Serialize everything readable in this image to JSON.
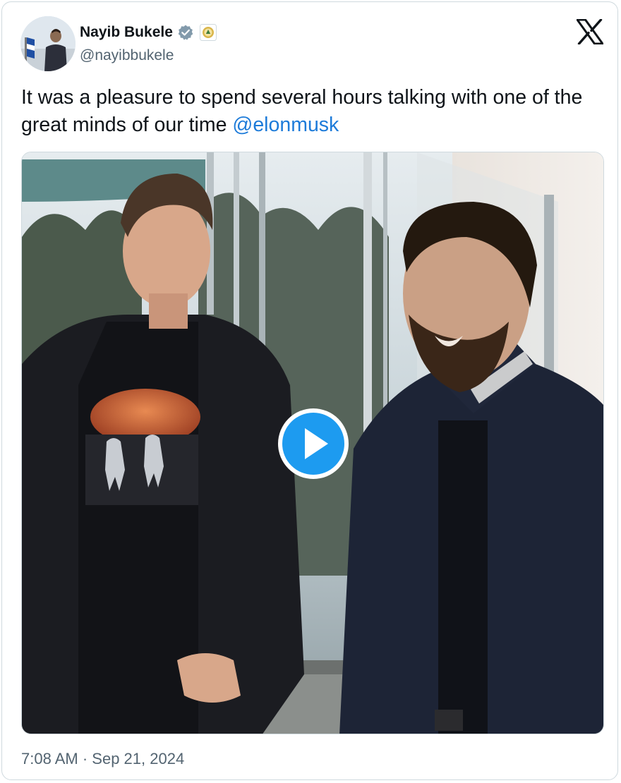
{
  "author": {
    "display_name": "Nayib Bukele",
    "handle": "@nayibbukele",
    "verified": true,
    "verified_icon": "verified-badge-icon",
    "affiliation_icon": "government-seal-icon",
    "avatar": "profile-avatar"
  },
  "platform_icon": "x-logo-icon",
  "tweet": {
    "text_before_mention": "It was a pleasure to spend several hours talking with one of the great minds of our time ",
    "mention": "@elonmusk"
  },
  "media": {
    "kind": "video",
    "play_icon": "play-icon"
  },
  "timestamp": {
    "time": "7:08 AM",
    "separator": " · ",
    "date": "Sep 21, 2024"
  },
  "colors": {
    "text": "#0f1419",
    "secondary_text": "#536471",
    "link": "#1d7bd9",
    "verified_badge": "#829aab",
    "play_button": "#1d9bf0",
    "border": "#cfd9de"
  }
}
